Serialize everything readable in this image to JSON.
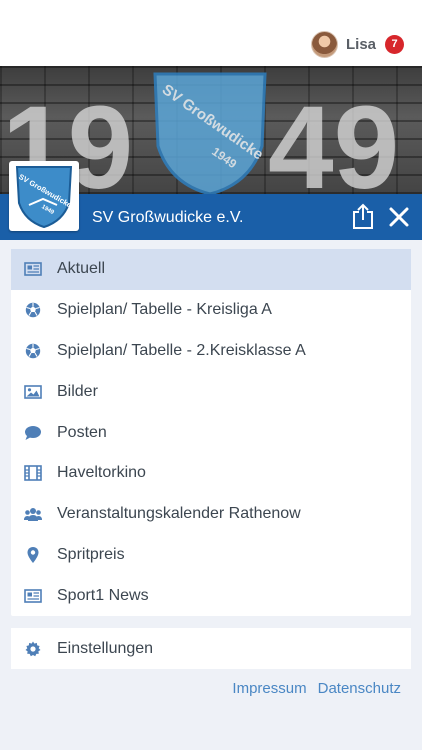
{
  "user": {
    "name": "Lisa",
    "notification_count": "7"
  },
  "banner": {
    "year_left": "19",
    "year_right": "49",
    "crest_text": "SV Großwudicke",
    "crest_year": "1949"
  },
  "club": {
    "name": "SV Großwudicke e.V.",
    "logo_text": "SV Großwudicke",
    "logo_year": "1949"
  },
  "menu": {
    "items": [
      {
        "label": "Aktuell",
        "icon": "newspaper-icon",
        "active": true
      },
      {
        "label": "Spielplan/ Tabelle - Kreisliga A",
        "icon": "soccer-ball-icon"
      },
      {
        "label": "Spielplan/ Tabelle - 2.Kreisklasse A",
        "icon": "soccer-ball-icon"
      },
      {
        "label": "Bilder",
        "icon": "image-icon"
      },
      {
        "label": "Posten",
        "icon": "chat-bubble-icon"
      },
      {
        "label": "Haveltorkino",
        "icon": "film-icon"
      },
      {
        "label": "Veranstaltungskalender Rathenow",
        "icon": "users-icon"
      },
      {
        "label": "Spritpreis",
        "icon": "map-pin-icon"
      },
      {
        "label": "Sport1 News",
        "icon": "newspaper-icon"
      }
    ],
    "settings_label": "Einstellungen"
  },
  "footer": {
    "impressum": "Impressum",
    "datenschutz": "Datenschutz"
  },
  "colors": {
    "primary": "#1a5fa8",
    "active_row": "#d3def0",
    "icon": "#4f7fb7",
    "badge": "#d7262b",
    "link": "#4a87c4"
  }
}
